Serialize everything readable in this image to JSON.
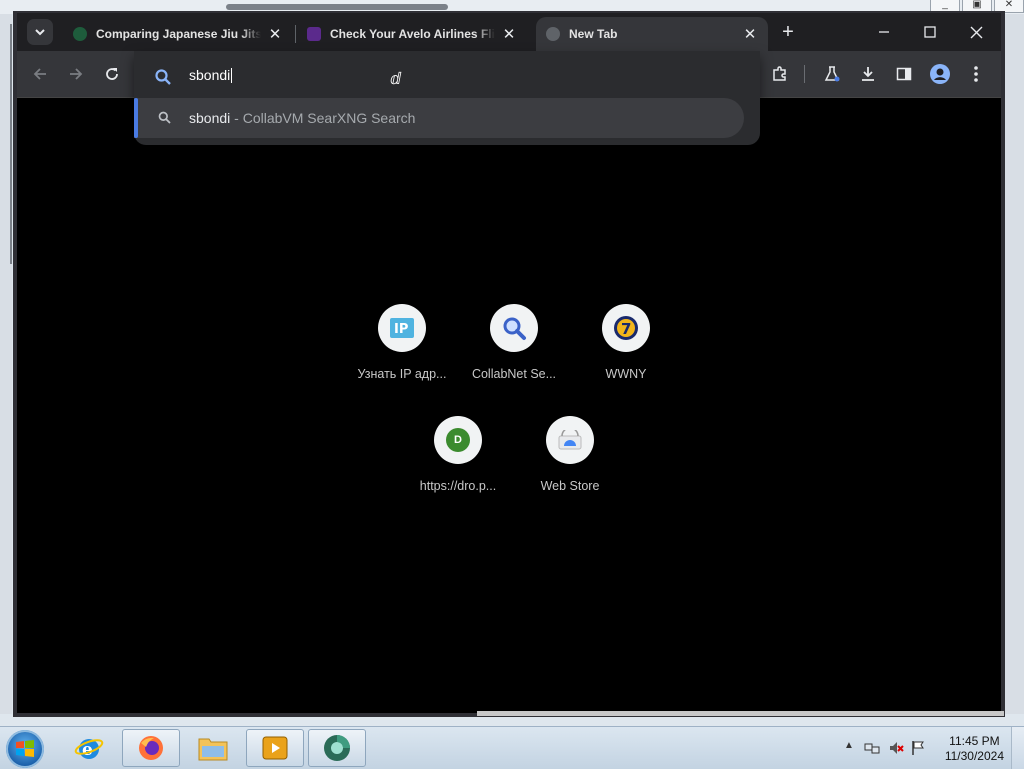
{
  "browser": {
    "tabs": [
      {
        "title": "Comparing Japanese Jiu Jitsu v",
        "favicon": "jiu-jitsu-favicon",
        "active": false
      },
      {
        "title": "Check Your Avelo Airlines Fligh",
        "favicon": "avelo-favicon",
        "active": false
      },
      {
        "title": "New Tab",
        "favicon": "globe-icon",
        "active": true
      }
    ],
    "window_controls": {
      "minimize": "—",
      "maximize": "☐",
      "close": "✕"
    },
    "new_tab_symbol": "+",
    "omnibox": {
      "typed_text": "sbondi",
      "suggestion": {
        "query": "sbondi",
        "separator": " - ",
        "description": "CollabVM SearXNG Search"
      }
    },
    "shortcuts": [
      {
        "label": "Узнать IP адр...",
        "icon": "ip-icon"
      },
      {
        "label": "CollabNet Se...",
        "icon": "magnifier-icon"
      },
      {
        "label": "WWNY",
        "icon": "wwny-7-icon"
      },
      {
        "label": "https://dro.p...",
        "icon": "letter-d-icon",
        "letter": "D"
      },
      {
        "label": "Web Store",
        "icon": "webstore-icon"
      }
    ],
    "colors": {
      "accent": "#4a7be3",
      "toolbar": "#35363a",
      "tabstrip": "#1f1f22",
      "page_bg": "#000000"
    }
  },
  "taskbar": {
    "apps": [
      "internet-explorer-icon",
      "firefox-icon",
      "file-explorer-icon",
      "media-player-icon",
      "chrome-dev-icon"
    ],
    "time": "11:45 PM",
    "date": "11/30/2024"
  }
}
